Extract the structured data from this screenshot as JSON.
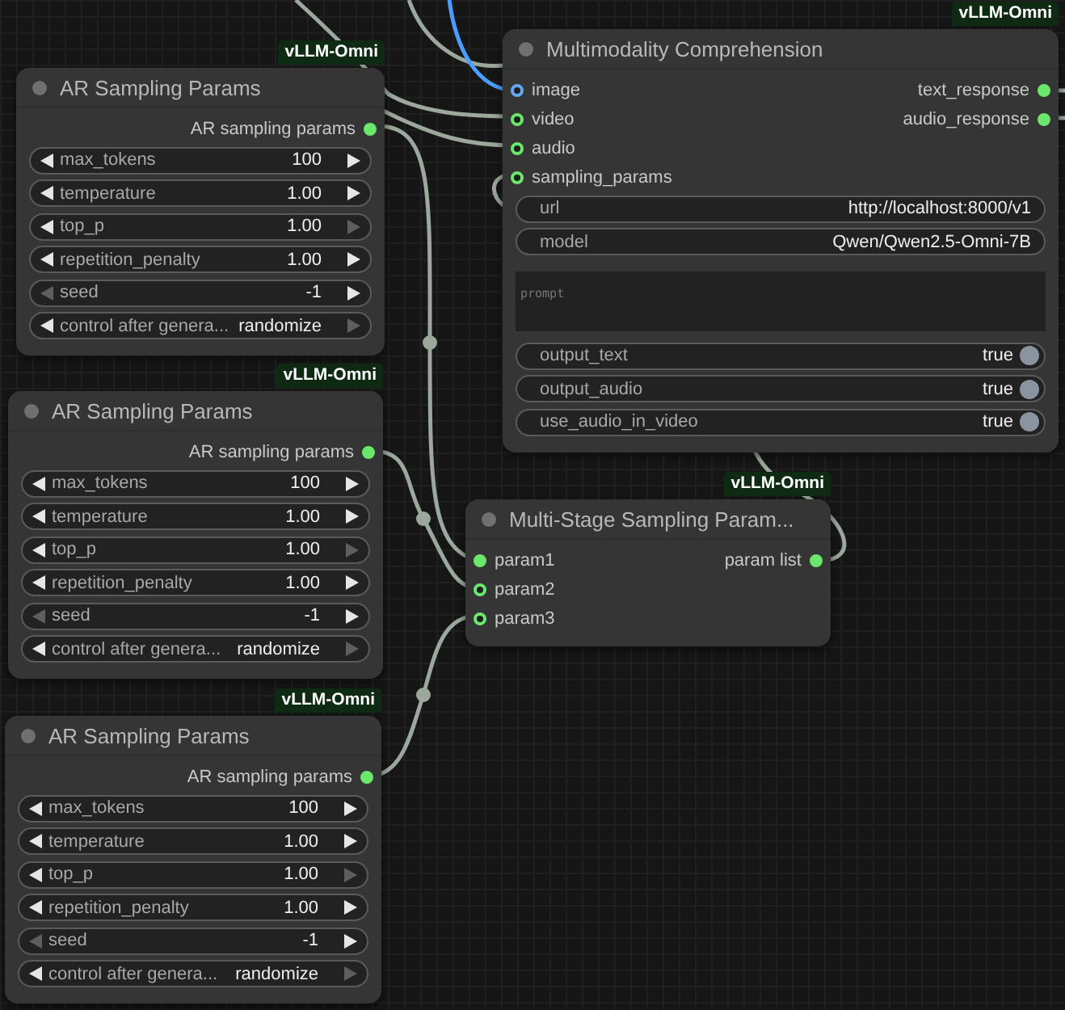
{
  "canvas": {
    "nodes": [
      {
        "title": "AR Sampling Params",
        "badge": "vLLM-Omni",
        "outputs": [
          {
            "label": "AR sampling params",
            "filled": true,
            "color": "#6be86b"
          }
        ],
        "widgets": [
          {
            "kind": "number",
            "label": "max_tokens",
            "value": "100",
            "dec_disabled": false,
            "inc_disabled": false
          },
          {
            "kind": "number",
            "label": "temperature",
            "value": "1.00",
            "dec_disabled": false,
            "inc_disabled": false
          },
          {
            "kind": "number",
            "label": "top_p",
            "value": "1.00",
            "dec_disabled": false,
            "inc_disabled": true
          },
          {
            "kind": "number",
            "label": "repetition_penalty",
            "value": "1.00",
            "dec_disabled": false,
            "inc_disabled": false
          },
          {
            "kind": "number",
            "label": "seed",
            "value": "-1",
            "dec_disabled": true,
            "inc_disabled": false
          },
          {
            "kind": "number",
            "label": "control after genera...",
            "value": "randomize",
            "dec_disabled": false,
            "inc_disabled": true
          }
        ]
      },
      {
        "title": "AR Sampling Params",
        "badge": "vLLM-Omni",
        "outputs": [
          {
            "label": "AR sampling params",
            "filled": true,
            "color": "#6be86b"
          }
        ],
        "widgets": [
          {
            "kind": "number",
            "label": "max_tokens",
            "value": "100",
            "dec_disabled": false,
            "inc_disabled": false
          },
          {
            "kind": "number",
            "label": "temperature",
            "value": "1.00",
            "dec_disabled": false,
            "inc_disabled": false
          },
          {
            "kind": "number",
            "label": "top_p",
            "value": "1.00",
            "dec_disabled": false,
            "inc_disabled": true
          },
          {
            "kind": "number",
            "label": "repetition_penalty",
            "value": "1.00",
            "dec_disabled": false,
            "inc_disabled": false
          },
          {
            "kind": "number",
            "label": "seed",
            "value": "-1",
            "dec_disabled": true,
            "inc_disabled": false
          },
          {
            "kind": "number",
            "label": "control after genera...",
            "value": "randomize",
            "dec_disabled": false,
            "inc_disabled": true
          }
        ]
      },
      {
        "title": "AR Sampling Params",
        "badge": "vLLM-Omni",
        "outputs": [
          {
            "label": "AR sampling params",
            "filled": true,
            "color": "#6be86b"
          }
        ],
        "widgets": [
          {
            "kind": "number",
            "label": "max_tokens",
            "value": "100",
            "dec_disabled": false,
            "inc_disabled": false
          },
          {
            "kind": "number",
            "label": "temperature",
            "value": "1.00",
            "dec_disabled": false,
            "inc_disabled": false
          },
          {
            "kind": "number",
            "label": "top_p",
            "value": "1.00",
            "dec_disabled": false,
            "inc_disabled": true
          },
          {
            "kind": "number",
            "label": "repetition_penalty",
            "value": "1.00",
            "dec_disabled": false,
            "inc_disabled": false
          },
          {
            "kind": "number",
            "label": "seed",
            "value": "-1",
            "dec_disabled": true,
            "inc_disabled": false
          },
          {
            "kind": "number",
            "label": "control after genera...",
            "value": "randomize",
            "dec_disabled": false,
            "inc_disabled": true
          }
        ]
      },
      {
        "title": "Multimodality Comprehension",
        "badge": "vLLM-Omni",
        "inputs": [
          {
            "label": "image",
            "filled": false,
            "color": "#64a8f0"
          },
          {
            "label": "video",
            "filled": false,
            "color": "#6be86b"
          },
          {
            "label": "audio",
            "filled": false,
            "color": "#6be86b"
          },
          {
            "label": "sampling_params",
            "filled": false,
            "color": "#6be86b"
          }
        ],
        "outputs": [
          {
            "label": "text_response",
            "filled": true,
            "color": "#6be86b"
          },
          {
            "label": "audio_response",
            "filled": true,
            "color": "#6be86b"
          }
        ],
        "widgets": [
          {
            "kind": "text",
            "label": "url",
            "value": "http://localhost:8000/v1"
          },
          {
            "kind": "text",
            "label": "model",
            "value": "Qwen/Qwen2.5-Omni-7B"
          },
          {
            "kind": "textarea",
            "placeholder": "prompt"
          },
          {
            "kind": "toggle",
            "label": "output_text",
            "value": "true",
            "on": true
          },
          {
            "kind": "toggle",
            "label": "output_audio",
            "value": "true",
            "on": true
          },
          {
            "kind": "toggle",
            "label": "use_audio_in_video",
            "value": "true",
            "on": true
          }
        ]
      },
      {
        "title": "Multi-Stage Sampling Param...",
        "badge": "vLLM-Omni",
        "inputs": [
          {
            "label": "param1",
            "filled": true,
            "color": "#6be86b"
          },
          {
            "label": "param2",
            "filled": false,
            "color": "#6be86b"
          },
          {
            "label": "param3",
            "filled": false,
            "color": "#6be86b"
          }
        ],
        "outputs": [
          {
            "label": "param list",
            "filled": true,
            "color": "#6be86b"
          }
        ]
      }
    ]
  }
}
